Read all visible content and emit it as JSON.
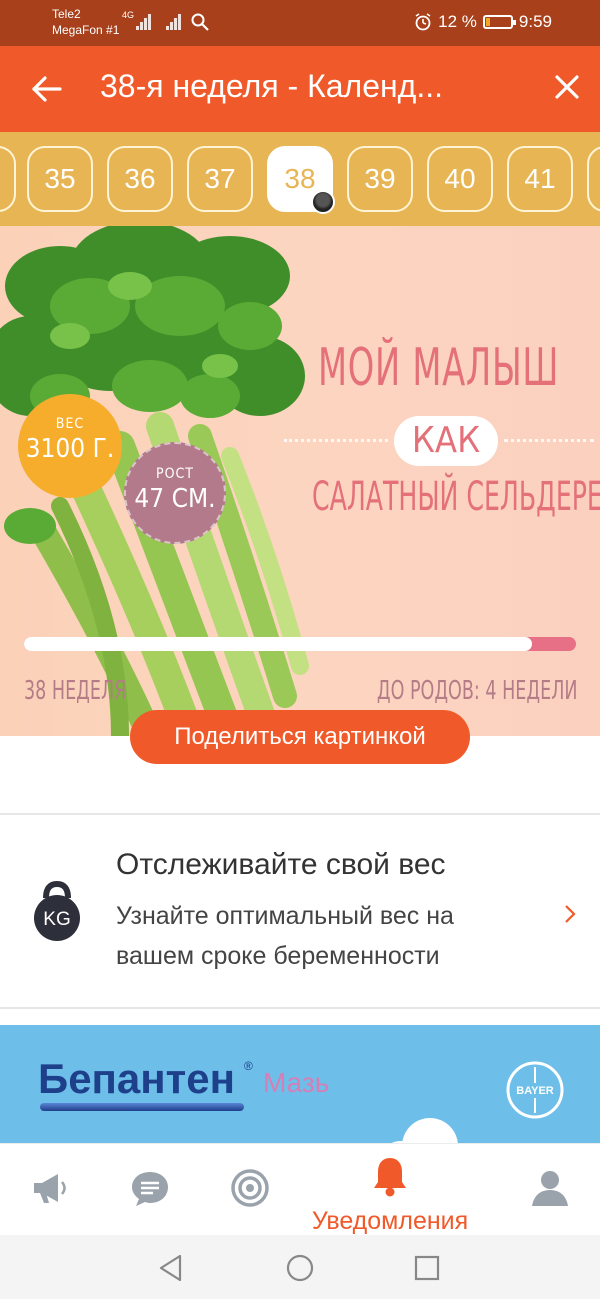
{
  "status_bar": {
    "carrier1": "Tele2",
    "carrier2": "MegaFon #1",
    "network": "4G",
    "battery": "12 %",
    "time": "9:59"
  },
  "header": {
    "title": "38-я неделя - Календ..."
  },
  "weeks": {
    "items": [
      "35",
      "36",
      "37",
      "38",
      "39",
      "40",
      "41"
    ],
    "selected": "38"
  },
  "banner": {
    "weight_label": "ВЕС",
    "weight_value": "3100 Г.",
    "height_label": "РОСТ",
    "height_value": "47 СМ.",
    "headline_line1": "МОЙ МАЛЫШ",
    "headline_kak": "КАК",
    "headline_line2": "САЛАТНЫЙ СЕЛЬДЕРЕЙ",
    "progress_fraction": 0.92,
    "week_label": "38 НЕДЕЛЯ",
    "remaining_label": "ДО РОДОВ: 4 НЕДЕЛИ"
  },
  "share_button": "Поделиться картинкой",
  "weight_card": {
    "title": "Отслеживайте свой вес",
    "subtitle": "Узнайте оптимальный вес на вашем сроке беременности",
    "icon_text": "KG"
  },
  "ad": {
    "brand": "Бепантен",
    "registered": "®",
    "product_type": "Мазь",
    "partner_logo": "BAYER"
  },
  "bottom_nav": {
    "active_label": "Уведомления"
  },
  "colors": {
    "status_bar": "#a8401c",
    "app_bar": "#f0592a",
    "weeks_bar": "#e8b555",
    "accent": "#f0592a",
    "headline_pink": "#e4707a",
    "ad_blue": "#6dbfe9"
  }
}
